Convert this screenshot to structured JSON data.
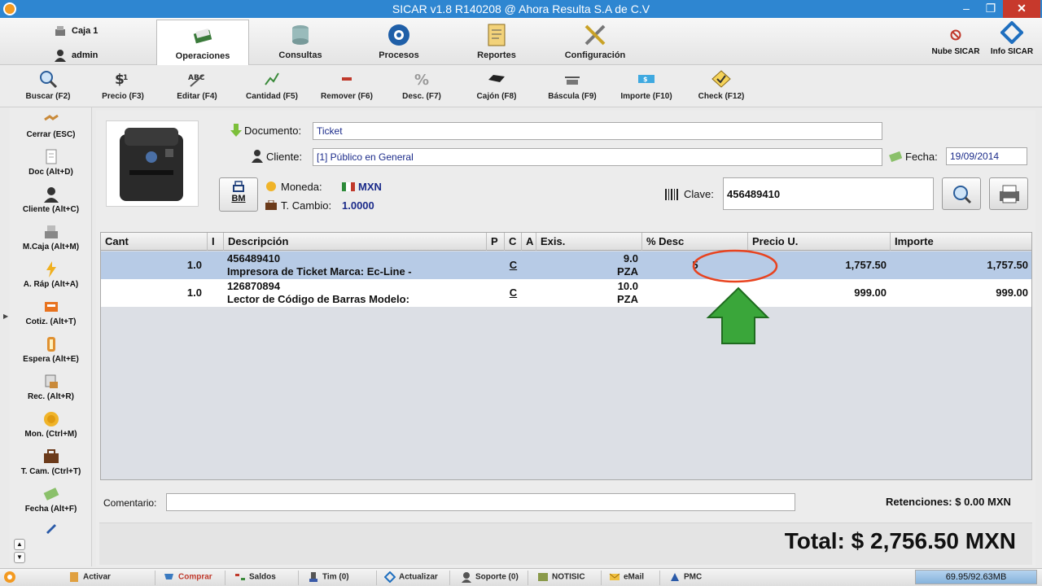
{
  "window": {
    "title": "SICAR v1.8 R140208 @ Ahora Resulta S.A de C.V"
  },
  "user": {
    "caja": "Caja 1",
    "name": "admin"
  },
  "modules": [
    {
      "label": "Operaciones",
      "icon": "operations-icon",
      "active": true
    },
    {
      "label": "Consultas",
      "icon": "database-icon"
    },
    {
      "label": "Procesos",
      "icon": "gear-process-icon"
    },
    {
      "label": "Reportes",
      "icon": "report-icon"
    },
    {
      "label": "Configuración",
      "icon": "tools-icon"
    }
  ],
  "sicar_links": {
    "nube": "Nube SICAR",
    "info": "Info SICAR"
  },
  "toolbar": [
    {
      "label": "Buscar (F2)",
      "icon": "magnifier-icon"
    },
    {
      "label": "Precio (F3)",
      "icon": "price-icon"
    },
    {
      "label": "Editar (F4)",
      "icon": "edit-icon"
    },
    {
      "label": "Cantidad (F5)",
      "icon": "quantity-icon"
    },
    {
      "label": "Remover (F6)",
      "icon": "remove-icon"
    },
    {
      "label": "Desc. (F7)",
      "icon": "percent-icon"
    },
    {
      "label": "Cajón (F8)",
      "icon": "drawer-icon"
    },
    {
      "label": "Báscula (F9)",
      "icon": "scale-icon"
    },
    {
      "label": "Importe (F10)",
      "icon": "money-icon"
    },
    {
      "label": "Check (F12)",
      "icon": "check-icon"
    }
  ],
  "sidebar": [
    {
      "label": "Cerrar (ESC)",
      "icon": "handshake-icon"
    },
    {
      "label": "Doc (Alt+D)",
      "icon": "document-icon"
    },
    {
      "label": "Cliente (Alt+C)",
      "icon": "client-icon"
    },
    {
      "label": "M.Caja (Alt+M)",
      "icon": "register-icon"
    },
    {
      "label": "A. Ráp (Alt+A)",
      "icon": "lightning-icon"
    },
    {
      "label": "Cotiz. (Alt+T)",
      "icon": "quote-icon"
    },
    {
      "label": "Espera (Alt+E)",
      "icon": "hourglass-icon"
    },
    {
      "label": "Rec. (Alt+R)",
      "icon": "receipt-icon"
    },
    {
      "label": "Mon. (Ctrl+M)",
      "icon": "coin-icon"
    },
    {
      "label": "T. Cam. (Ctrl+T)",
      "icon": "briefcase-icon"
    },
    {
      "label": "Fecha (Alt+F)",
      "icon": "date-icon"
    }
  ],
  "form": {
    "documento_label": "Documento:",
    "documento_value": "Ticket",
    "cliente_label": "Cliente:",
    "cliente_value": "[1] Público en General",
    "fecha_label": "Fecha:",
    "fecha_value": "19/09/2014",
    "bm_label": "BM",
    "moneda_label": "Moneda:",
    "moneda_value": "MXN",
    "tcambio_label": "T. Cambio:",
    "tcambio_value": "1.0000",
    "clave_label": "Clave:",
    "clave_value": "456489410"
  },
  "table": {
    "headers": [
      "Cant",
      "I",
      "Descripción",
      "P",
      "C",
      "A",
      "Exis.",
      "% Desc",
      "Precio U.",
      "Importe"
    ],
    "rows": [
      {
        "cant": "1.0",
        "code": "456489410",
        "desc": "Impresora de Ticket Marca: Ec-Line -",
        "c": "C",
        "exis": "9.0",
        "unit": "PZA",
        "desc_pct": "5",
        "precio": "1,757.50",
        "importe": "1,757.50"
      },
      {
        "cant": "1.0",
        "code": "126870894",
        "desc": "Lector de Código de Barras Modelo:",
        "c": "C",
        "exis": "10.0",
        "unit": "PZA",
        "desc_pct": "",
        "precio": "999.00",
        "importe": "999.00"
      }
    ]
  },
  "bottom": {
    "comentario_label": "Comentario:",
    "retenciones": "Retenciones:  $ 0.00 MXN",
    "total": "Total:  $ 2,756.50 MXN"
  },
  "statusbar": [
    {
      "label": "Activar",
      "icon": "activate-icon"
    },
    {
      "label": "Comprar",
      "icon": "cart-icon",
      "color": "#c0392b"
    },
    {
      "label": "Saldos",
      "icon": "balance-icon"
    },
    {
      "label": "Tim (0)",
      "icon": "stamp-icon"
    },
    {
      "label": "Actualizar",
      "icon": "update-icon"
    },
    {
      "label": "Soporte (0)",
      "icon": "support-icon"
    },
    {
      "label": "NOTISIC",
      "icon": "news-icon"
    },
    {
      "label": "eMail",
      "icon": "email-icon"
    },
    {
      "label": "PMC",
      "icon": "pmc-icon"
    }
  ],
  "memory": "69.95/92.63MB",
  "colors": {
    "titlebar": "#2e86d1",
    "selected_row": "#b7cbe6",
    "highlight_circle": "#e8431f",
    "arrow_green": "#3aa63a",
    "value_blue": "#1b2b8a"
  }
}
